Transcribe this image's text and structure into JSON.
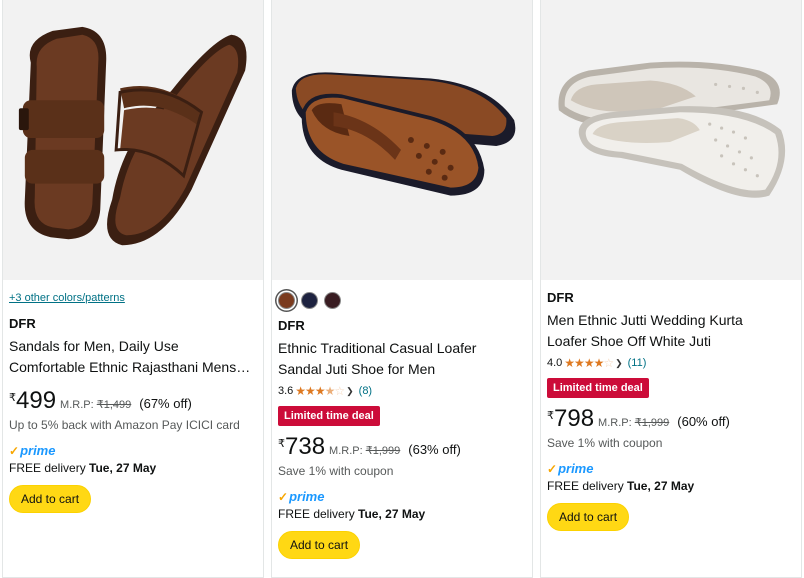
{
  "products": [
    {
      "colors_link": "+3 other colors/patterns",
      "brand": "DFR",
      "title": "Sandals for Men, Daily Use Comfortable Ethnic Rajasthani Mens…",
      "price_symbol": "₹",
      "price": "499",
      "mrp_label": "M.R.P:",
      "mrp": "₹1,499",
      "discount": "(67% off)",
      "extra": "Up to 5% back with Amazon Pay ICICI card",
      "prime_label": "prime",
      "delivery_prefix": "FREE delivery",
      "delivery_date": "Tue, 27 May",
      "cart_label": "Add to cart"
    },
    {
      "swatch_colors": [
        "#7a3b1f",
        "#1e2340",
        "#3a1d22"
      ],
      "brand": "DFR",
      "title_line1": "Ethnic Traditional Casual Loafer",
      "title_line2": "Sandal Juti Shoe for Men",
      "rating": "3.6",
      "rating_value": 3.6,
      "review_count": "(8)",
      "deal_label": "Limited time deal",
      "price_symbol": "₹",
      "price": "738",
      "mrp_label": "M.R.P:",
      "mrp": "₹1,999",
      "discount": "(63% off)",
      "extra": "Save 1% with coupon",
      "prime_label": "prime",
      "delivery_prefix": "FREE delivery",
      "delivery_date": "Tue, 27 May",
      "cart_label": "Add to cart"
    },
    {
      "brand": "DFR",
      "title_line1": "Men Ethnic Jutti Wedding Kurta",
      "title_line2": "Loafer Shoe Off White Juti",
      "rating": "4.0",
      "rating_value": 4.0,
      "review_count": "(11)",
      "deal_label": "Limited time deal",
      "price_symbol": "₹",
      "price": "798",
      "mrp_label": "M.R.P:",
      "mrp": "₹1,999",
      "discount": "(60% off)",
      "extra": "Save 1% with coupon",
      "prime_label": "prime",
      "delivery_prefix": "FREE delivery",
      "delivery_date": "Tue, 27 May",
      "cart_label": "Add to cart"
    }
  ],
  "colors": {
    "accent_button": "#ffd814",
    "deal_badge": "#cc0c39",
    "link": "#007185",
    "star": "#de7921",
    "prime": "#1a98ff"
  }
}
